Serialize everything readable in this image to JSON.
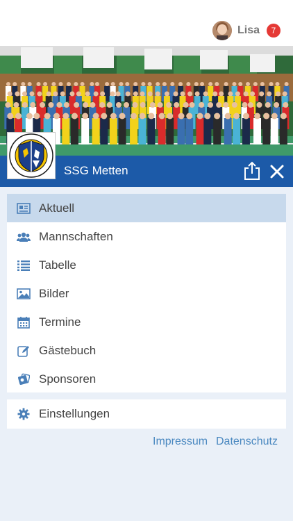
{
  "header": {
    "user_name": "Lisa",
    "notification_count": "7"
  },
  "team": {
    "name": "SSG Metten",
    "logo_text_top": "HANDBALL",
    "logo_text_bottom": "SSG METTEN"
  },
  "menu": {
    "items": [
      {
        "label": "Aktuell",
        "icon": "newspaper-icon",
        "active": true
      },
      {
        "label": "Mannschaften",
        "icon": "users-icon",
        "active": false
      },
      {
        "label": "Tabelle",
        "icon": "list-icon",
        "active": false
      },
      {
        "label": "Bilder",
        "icon": "image-icon",
        "active": false
      },
      {
        "label": "Termine",
        "icon": "calendar-icon",
        "active": false
      },
      {
        "label": "Gästebuch",
        "icon": "edit-icon",
        "active": false
      },
      {
        "label": "Sponsoren",
        "icon": "handshake-icon",
        "active": false
      }
    ],
    "settings_label": "Einstellungen"
  },
  "footer": {
    "impressum": "Impressum",
    "datenschutz": "Datenschutz"
  },
  "colors": {
    "brand_blue": "#1c5aa8",
    "active_row": "#c7d9ec",
    "icon_blue": "#4a7fb8",
    "link_blue": "#4a88c0",
    "badge_red": "#e53935",
    "background": "#eaf0f8"
  }
}
